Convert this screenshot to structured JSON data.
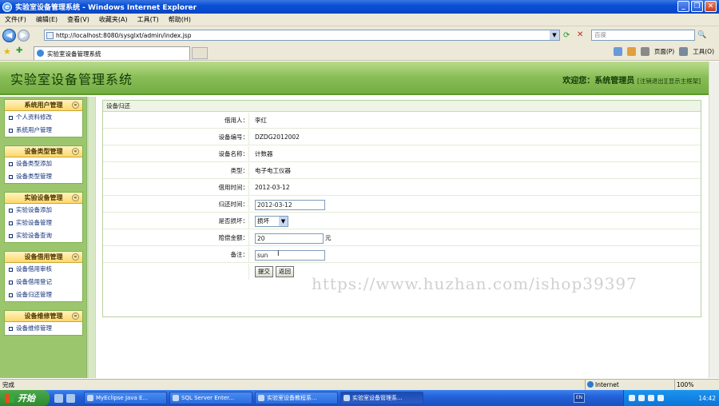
{
  "window": {
    "title": "实验室设备管理系统 - Windows Internet Explorer"
  },
  "menu": [
    "文件(F)",
    "编辑(E)",
    "查看(V)",
    "收藏夹(A)",
    "工具(T)",
    "帮助(H)"
  ],
  "address": {
    "url": "http://localhost:8080/sysglxt/admin/index.jsp",
    "search_placeholder": "百度"
  },
  "tab": {
    "label": "实验室设备管理系统"
  },
  "commands": {
    "page": "页面(P)",
    "tools": "工具(O)"
  },
  "app": {
    "title": "实验室设备管理系统",
    "welcome_prefix": "欢迎您：",
    "user": "系统管理员",
    "logout": "[注销退出]",
    "home": "[显示主框架]"
  },
  "sidebar": {
    "groups": [
      {
        "title": "系统用户管理",
        "items": [
          "个人资料修改",
          "系统用户管理"
        ]
      },
      {
        "title": "设备类型管理",
        "items": [
          "设备类型添加",
          "设备类型管理"
        ]
      },
      {
        "title": "实验设备管理",
        "items": [
          "实验设备添加",
          "实验设备管理",
          "实验设备查询"
        ]
      },
      {
        "title": "设备借用管理",
        "items": [
          "设备借用审核",
          "设备借用登记",
          "设备归还管理"
        ]
      },
      {
        "title": "设备维修管理",
        "items": [
          "设备维修管理"
        ]
      }
    ]
  },
  "form": {
    "heading": "设备归还",
    "labels": {
      "borrower": "借用人：",
      "device_no": "设备编号：",
      "device_name": "设备名称：",
      "type": "类型：",
      "borrow_time": "借用时间：",
      "return_time": "归还时间：",
      "damaged": "是否损坏：",
      "compensation": "赔偿金额：",
      "remarks": "备注："
    },
    "values": {
      "borrower": "李红",
      "device_no": "DZDG2012002",
      "device_name": "计数器",
      "type": "电子电工仪器",
      "borrow_time": "2012-03-12",
      "return_time": "2012-03-12",
      "damaged": "损坏",
      "compensation": "20",
      "remarks": "sun"
    },
    "unit": "元",
    "submit": "提交",
    "back": "返回"
  },
  "watermark": "https://www.huzhan.com/ishop39397",
  "status": {
    "text": "完成",
    "zone": "Internet",
    "zoom": "100%"
  },
  "taskbar": {
    "start": "开始",
    "tasks": [
      "MyEclipse Java E...",
      "SQL Server Enter...",
      "实验室设备教程系...",
      "实验室设备管理系..."
    ],
    "clock": "14:42"
  }
}
